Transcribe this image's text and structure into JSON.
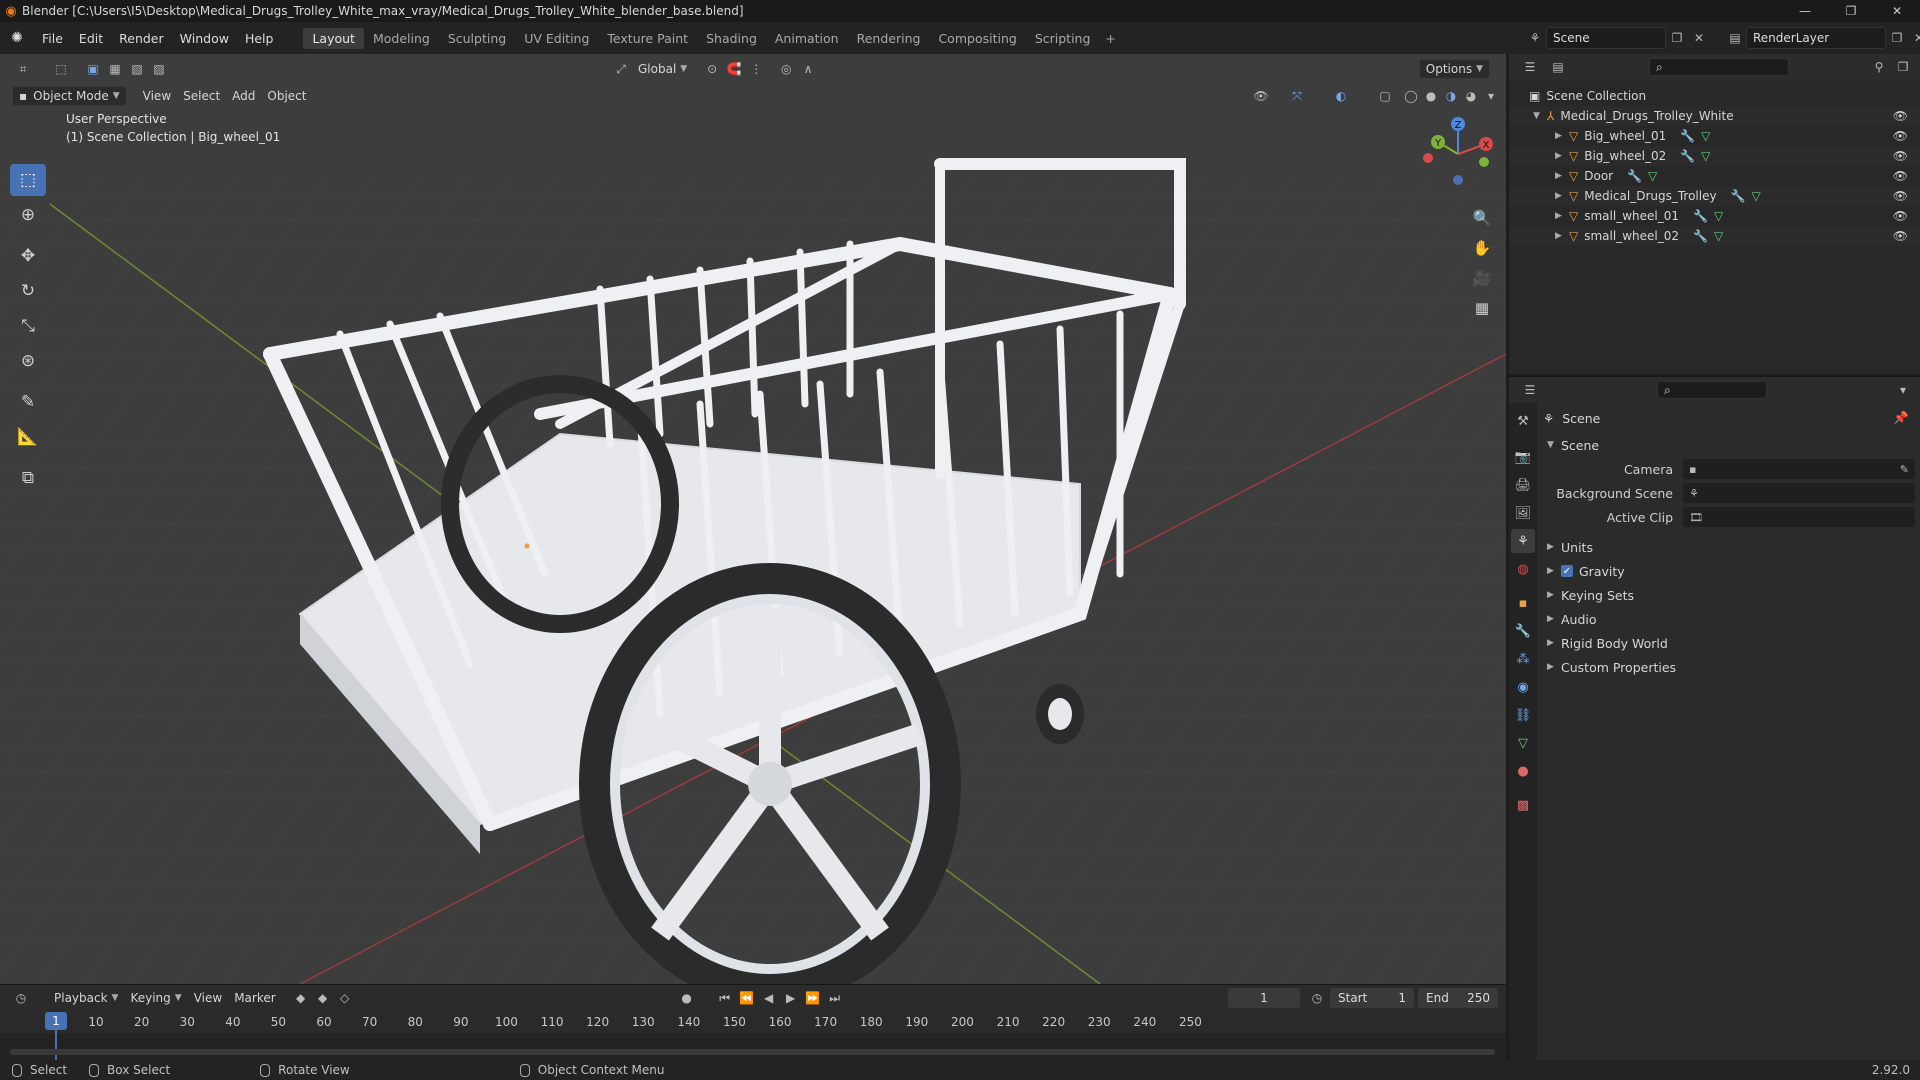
{
  "window": {
    "title": "Blender [C:\\Users\\I5\\Desktop\\Medical_Drugs_Trolley_White_max_vray/Medical_Drugs_Trolley_White_blender_base.blend]",
    "controls": [
      "—",
      "❐",
      "✕"
    ]
  },
  "menubar": {
    "items": [
      "File",
      "Edit",
      "Render",
      "Window",
      "Help"
    ],
    "workspaces": [
      "Layout",
      "Modeling",
      "Sculpting",
      "UV Editing",
      "Texture Paint",
      "Shading",
      "Animation",
      "Rendering",
      "Compositing",
      "Scripting"
    ],
    "active_workspace": "Layout",
    "add_tab": "+",
    "scene_name": "Scene",
    "render_layer": "RenderLayer"
  },
  "viewport": {
    "mode": "Object Mode",
    "menus": [
      "View",
      "Select",
      "Add",
      "Object"
    ],
    "orientation": "Global",
    "options_label": "Options",
    "perspective_label": "User Perspective",
    "collection_label": "(1) Scene Collection | Big_wheel_01",
    "tools": [
      "select-box",
      "cursor",
      "move",
      "rotate",
      "scale",
      "transform",
      "annotate",
      "measure",
      "add-cube"
    ],
    "gizmo": {
      "x": "X",
      "y": "Y",
      "z": "Z"
    }
  },
  "outliner": {
    "root": "Scene Collection",
    "collection": "Medical_Drugs_Trolley_White",
    "objects": [
      "Big_wheel_01",
      "Big_wheel_02",
      "Door",
      "Medical_Drugs_Trolley",
      "small_wheel_01",
      "small_wheel_02"
    ]
  },
  "properties": {
    "header": "Scene",
    "panel_title": "Scene",
    "fields": [
      {
        "label": "Camera",
        "value": ""
      },
      {
        "label": "Background Scene",
        "value": ""
      },
      {
        "label": "Active Clip",
        "value": ""
      }
    ],
    "subpanels": [
      "Units",
      "Gravity",
      "Keying Sets",
      "Audio",
      "Rigid Body World",
      "Custom Properties"
    ],
    "gravity_checked": true
  },
  "timeline": {
    "menus": [
      "Playback",
      "Keying",
      "View",
      "Marker"
    ],
    "current_frame": "1",
    "start_label": "Start",
    "start": "1",
    "end_label": "End",
    "end": "250",
    "ticks": [
      "10",
      "20",
      "30",
      "40",
      "50",
      "60",
      "70",
      "80",
      "90",
      "100",
      "110",
      "120",
      "130",
      "140",
      "150",
      "160",
      "170",
      "180",
      "190",
      "200",
      "210",
      "220",
      "230",
      "240",
      "250"
    ]
  },
  "statusbar": {
    "items": [
      "Select",
      "Box Select",
      "Rotate View",
      "Object Context Menu"
    ],
    "version": "2.92.0"
  },
  "colors": {
    "accent": "#4772b3",
    "object_orange": "#e8a04a",
    "mesh_green": "#5fcf7a"
  }
}
